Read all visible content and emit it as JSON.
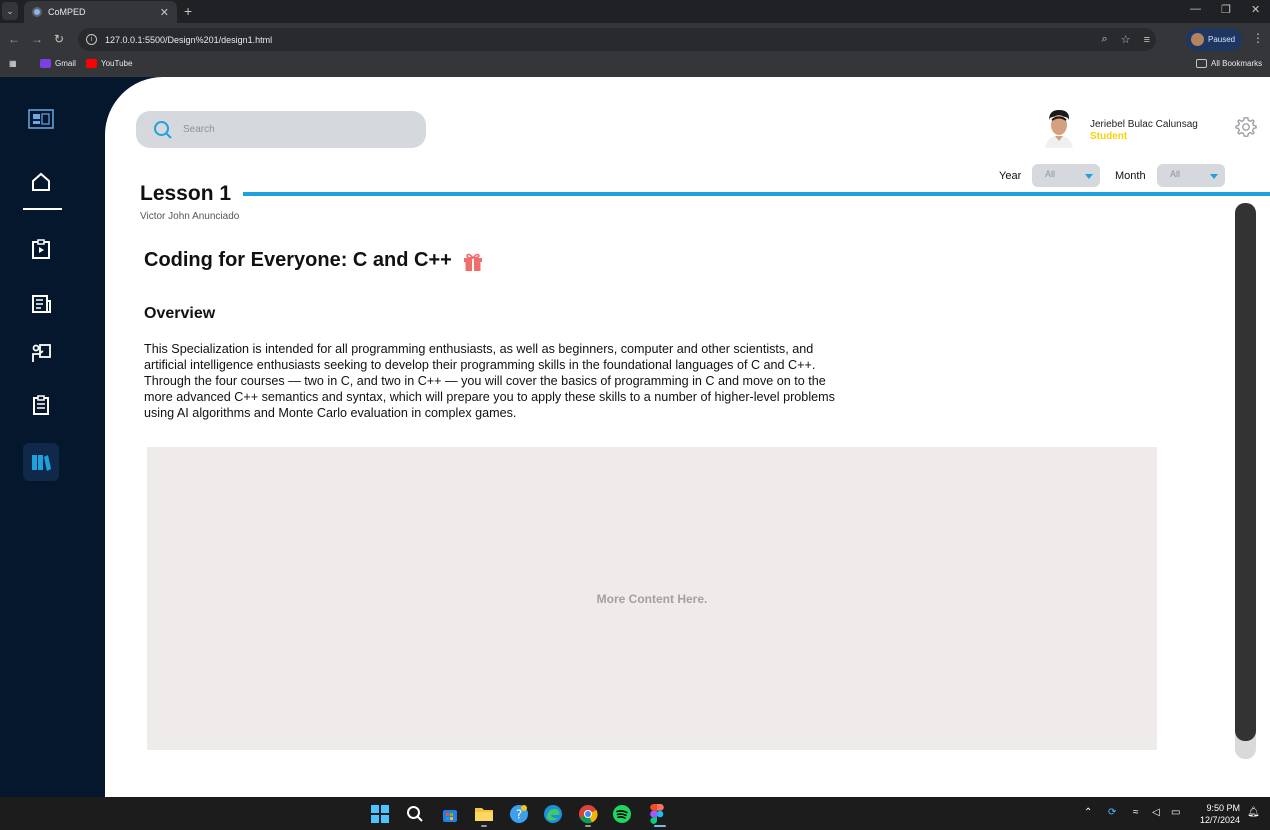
{
  "browser": {
    "tab_title": "CoMPED",
    "url": "127.0.0.1:5500/Design%201/design1.html",
    "profile_label": "Paused",
    "bookmarks": [
      "Gmail",
      "YouTube"
    ],
    "all_bookmarks": "All Bookmarks"
  },
  "sidebar": {
    "items": [
      {
        "icon": "logo-icon"
      },
      {
        "icon": "home-icon"
      },
      {
        "icon": "video-clipboard-icon"
      },
      {
        "icon": "newspaper-icon"
      },
      {
        "icon": "teacher-board-icon"
      },
      {
        "icon": "clipboard-icon"
      },
      {
        "icon": "library-books-icon",
        "active": true
      }
    ]
  },
  "search": {
    "placeholder": "Search"
  },
  "user": {
    "name": "Jeriebel Bulac Calunsag",
    "role": "Student"
  },
  "filters": {
    "year_label": "Year",
    "year_value": "All",
    "month_label": "Month",
    "month_value": "All"
  },
  "lesson": {
    "title": "Lesson 1",
    "author": "Victor John Anunciado",
    "course_title": "Coding for Everyone: C and C++",
    "overview_heading": "Overview",
    "description": "This Specialization is intended for all programming enthusiasts, as well as beginners, computer and other scientists, and\n artificial intelligence enthusiasts seeking to develop their programming skills in the foundational languages of C and C++.\nThrough the four courses — two in C, and two in C++ — you will cover the basics of programming in C and move on to the\nmore advanced C++ semantics and syntax, which will prepare you to apply these skills to a number of higher-level problems\nusing AI algorithms and Monte Carlo evaluation in complex games.",
    "more_content": "More Content Here."
  },
  "taskbar": {
    "time": "9:50 PM",
    "date": "12/7/2024"
  },
  "colors": {
    "sidebar": "#04172c",
    "accent": "#1ea2dd",
    "role": "#f5d10a",
    "content_box": "#efebea"
  }
}
